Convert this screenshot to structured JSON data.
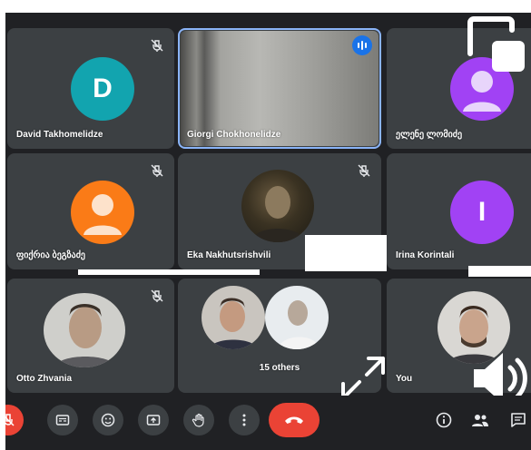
{
  "participants": [
    {
      "name": "David Takhomelidze",
      "initial": "D",
      "color": "#12a4af",
      "muted": true
    },
    {
      "name": "Giorgi Chokhonelidze",
      "speaking": true
    },
    {
      "name": "ელენე ლომიძე",
      "type": "silhouette",
      "color": "#a142f4"
    },
    {
      "name": "ფიქრია ბეგზაძე",
      "type": "silhouette",
      "color": "#fa7b17",
      "muted": true
    },
    {
      "name": "Eka Nakhutsrishvili",
      "muted": true
    },
    {
      "name": "Irina Korintali",
      "initial": "I",
      "color": "#a142f4"
    },
    {
      "name": "Otto Zhvania",
      "muted": true
    },
    {
      "name": "15 others"
    },
    {
      "name": "You"
    }
  ],
  "toolbar": {
    "buttons": [
      "mic-off",
      "captions",
      "raise-hand",
      "present",
      "hand",
      "more"
    ],
    "hangup": "leave-call",
    "right": [
      "info",
      "people",
      "chat"
    ]
  },
  "colors": {
    "background": "#202124",
    "tile": "#3c4043",
    "accent": "#1a73e8",
    "hangup": "#ea4335"
  }
}
